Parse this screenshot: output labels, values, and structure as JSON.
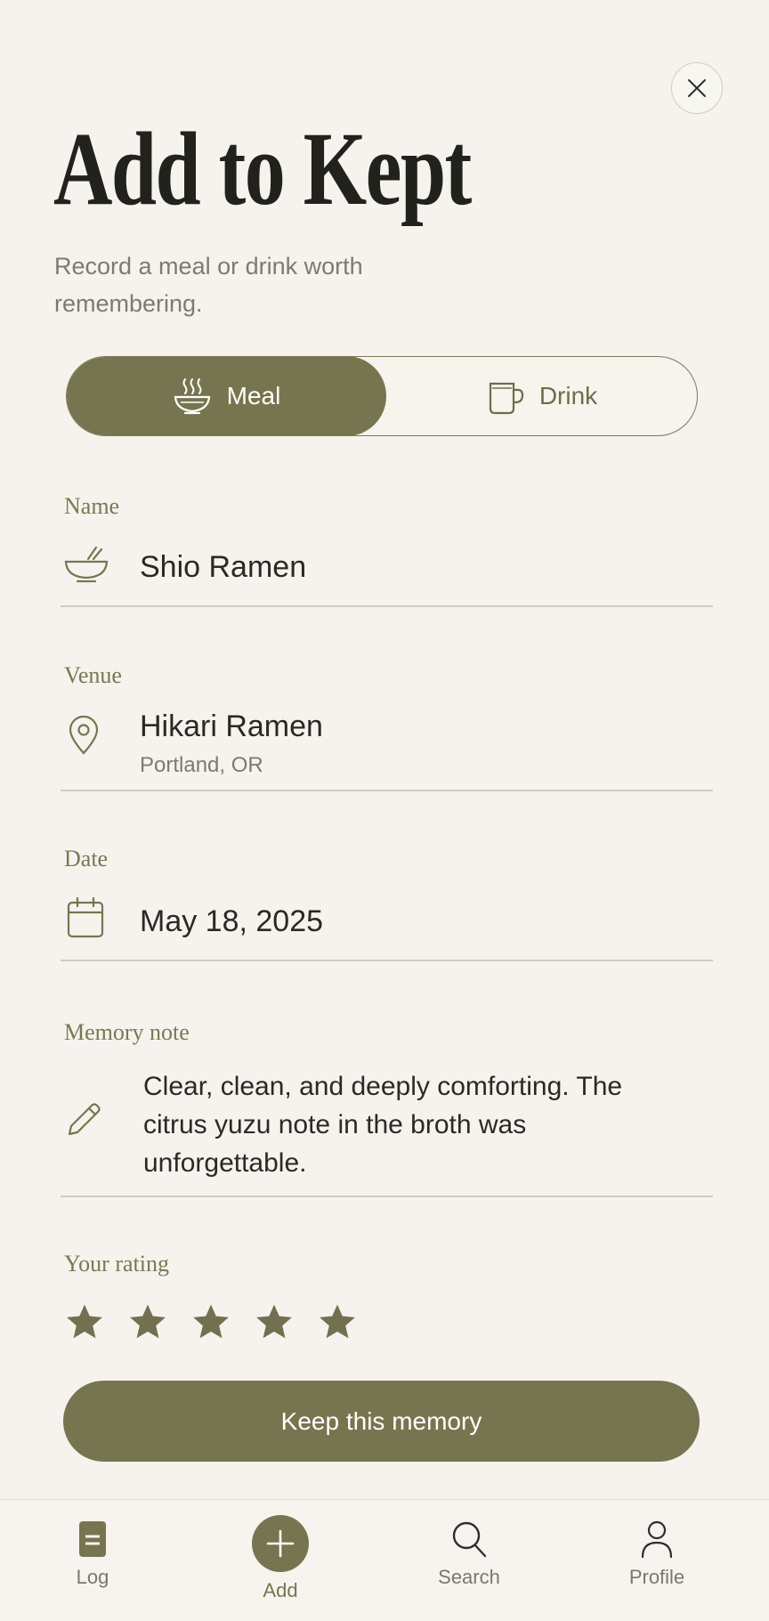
{
  "header": {
    "title": "Add to Kept",
    "subtitle": "Record a meal or drink worth remembering."
  },
  "type_toggle": {
    "options": [
      {
        "label": "Meal",
        "icon": "steaming-bowl-icon",
        "selected": true
      },
      {
        "label": "Drink",
        "icon": "mug-icon",
        "selected": false
      }
    ]
  },
  "fields": {
    "name": {
      "label": "Name",
      "value": "Shio Ramen",
      "icon": "noodle-bowl-icon"
    },
    "venue": {
      "label": "Venue",
      "value": "Hikari Ramen",
      "sub": "Portland, OR",
      "icon": "location-pin-icon"
    },
    "date": {
      "label": "Date",
      "value": "May 18, 2025",
      "icon": "calendar-icon"
    },
    "note": {
      "label": "Memory note",
      "value": "Clear, clean, and deeply comforting. The citrus yuzu note in the broth was unforgettable.",
      "icon": "pencil-icon"
    },
    "rating": {
      "label": "Your rating",
      "value": 5,
      "max": 5
    }
  },
  "actions": {
    "primary_label": "Keep this memory"
  },
  "tabbar": {
    "items": [
      {
        "label": "Log",
        "icon": "log-icon"
      },
      {
        "label": "Add",
        "icon": "add-icon",
        "active": true
      },
      {
        "label": "Search",
        "icon": "search-icon"
      },
      {
        "label": "Profile",
        "icon": "profile-icon"
      }
    ]
  },
  "colors": {
    "accent": "#77754f",
    "background": "#f6f3ee",
    "text": "#2a2a24",
    "muted": "#7d7a72"
  }
}
